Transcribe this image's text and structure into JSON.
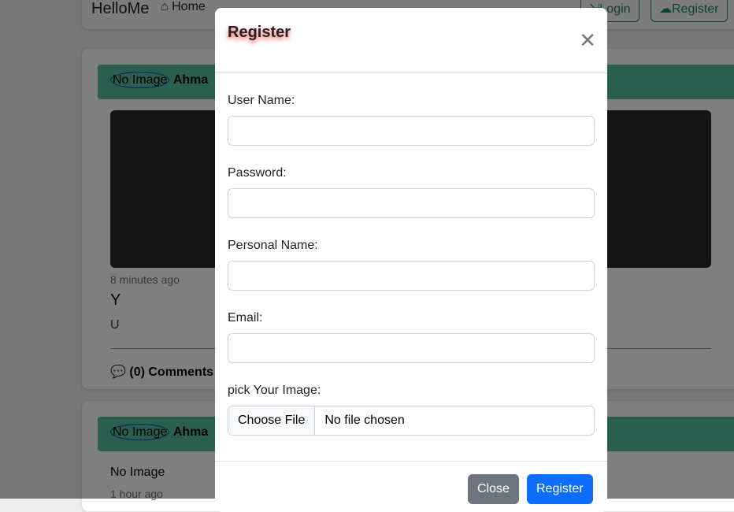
{
  "navbar": {
    "brand": "HelloMe",
    "home": "Home",
    "login": "Login",
    "register": "Register"
  },
  "posts": [
    {
      "avatar_alt": "No Image",
      "author": "Ahma",
      "time": "8 minutes ago",
      "title": "Y",
      "body": "U",
      "comments": "(0) Comments"
    },
    {
      "avatar_alt": "No Image",
      "author": "Ahma",
      "image_alt": "No Image",
      "time": "1 hour ago"
    }
  ],
  "modal": {
    "title": "Register",
    "fields": [
      {
        "label": "User Name:",
        "value": ""
      },
      {
        "label": "Password:",
        "value": ""
      },
      {
        "label": "Personal Name:",
        "value": ""
      },
      {
        "label": "Email:",
        "value": ""
      }
    ],
    "image_label": "pick Your Image:",
    "choose_file": "Choose File",
    "no_file": "No file chosen",
    "close": "Close",
    "register": "Register"
  }
}
